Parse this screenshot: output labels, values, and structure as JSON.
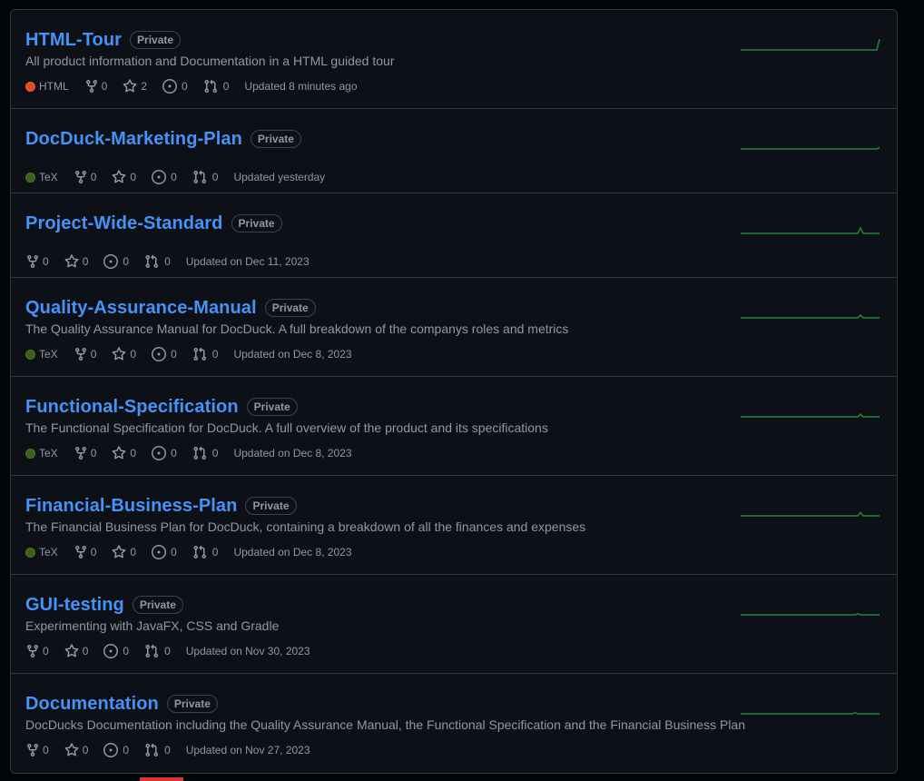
{
  "repos": [
    {
      "name": "HTML-Tour",
      "badge": "Private",
      "description": "All product information and Documentation in a HTML guided tour",
      "language": "HTML",
      "language_color": "#e34c26",
      "forks": "0",
      "stars": "2",
      "issues": "0",
      "pulls": "0",
      "updated": "Updated 8 minutes ago",
      "activity": [
        0,
        0,
        0,
        0,
        0,
        0,
        0,
        0,
        0,
        0,
        0,
        0,
        0,
        0,
        0,
        0,
        0,
        0,
        0,
        0,
        0,
        0,
        0,
        0,
        0,
        0,
        0,
        0,
        0,
        0,
        0,
        0,
        0,
        0,
        0,
        0,
        0,
        0,
        0,
        0,
        0,
        0,
        0,
        0,
        0,
        0,
        0,
        0,
        0,
        0,
        0,
        1
      ]
    },
    {
      "name": "DocDuck-Marketing-Plan",
      "badge": "Private",
      "description": "",
      "language": "TeX",
      "language_color": "#3d6117",
      "forks": "0",
      "stars": "0",
      "issues": "0",
      "pulls": "0",
      "updated": "Updated yesterday",
      "activity": [
        0,
        0,
        0,
        0,
        0,
        0,
        0,
        0,
        0,
        0,
        0,
        0,
        0,
        0,
        0,
        0,
        0,
        0,
        0,
        0,
        0,
        0,
        0,
        0,
        0,
        0,
        0,
        0,
        0,
        0,
        0,
        0,
        0,
        0,
        0,
        0,
        0,
        0,
        0,
        0,
        0,
        0,
        0,
        0,
        0,
        0,
        0,
        0,
        0,
        0,
        0,
        0.15
      ]
    },
    {
      "name": "Project-Wide-Standard",
      "badge": "Private",
      "description": "",
      "language": "",
      "language_color": "",
      "forks": "0",
      "stars": "0",
      "issues": "0",
      "pulls": "0",
      "updated": "Updated on Dec 11, 2023",
      "activity": [
        0,
        0,
        0,
        0,
        0,
        0,
        0,
        0,
        0,
        0,
        0,
        0,
        0,
        0,
        0,
        0,
        0,
        0,
        0,
        0,
        0,
        0,
        0,
        0,
        0,
        0,
        0,
        0,
        0,
        0,
        0,
        0,
        0,
        0,
        0,
        0,
        0,
        0,
        0,
        0,
        0,
        0,
        0,
        0,
        0.5,
        0,
        0,
        0,
        0,
        0,
        0,
        0
      ]
    },
    {
      "name": "Quality-Assurance-Manual",
      "badge": "Private",
      "description": "The Quality Assurance Manual for DocDuck. A full breakdown of the companys roles and metrics",
      "language": "TeX",
      "language_color": "#3d6117",
      "forks": "0",
      "stars": "0",
      "issues": "0",
      "pulls": "0",
      "updated": "Updated on Dec 8, 2023",
      "activity": [
        0,
        0,
        0,
        0,
        0,
        0,
        0,
        0,
        0,
        0,
        0,
        0,
        0,
        0,
        0,
        0,
        0,
        0,
        0,
        0,
        0,
        0,
        0,
        0,
        0,
        0,
        0,
        0,
        0,
        0,
        0,
        0,
        0,
        0,
        0,
        0,
        0,
        0,
        0,
        0,
        0,
        0,
        0,
        0,
        0.25,
        0,
        0,
        0,
        0,
        0,
        0,
        0
      ]
    },
    {
      "name": "Functional-Specification",
      "badge": "Private",
      "description": "The Functional Specification for DocDuck. A full overview of the product and its specifications",
      "language": "TeX",
      "language_color": "#3d6117",
      "forks": "0",
      "stars": "0",
      "issues": "0",
      "pulls": "0",
      "updated": "Updated on Dec 8, 2023",
      "activity": [
        0,
        0,
        0,
        0,
        0,
        0,
        0,
        0,
        0,
        0,
        0,
        0,
        0,
        0,
        0,
        0,
        0,
        0,
        0,
        0,
        0,
        0,
        0,
        0,
        0,
        0,
        0,
        0,
        0,
        0,
        0,
        0,
        0,
        0,
        0,
        0,
        0,
        0,
        0,
        0,
        0,
        0,
        0,
        0,
        0.25,
        0,
        0,
        0,
        0,
        0,
        0,
        0
      ]
    },
    {
      "name": "Financial-Business-Plan",
      "badge": "Private",
      "description": "The Financial Business Plan for DocDuck, containing a breakdown of all the finances and expenses",
      "language": "TeX",
      "language_color": "#3d6117",
      "forks": "0",
      "stars": "0",
      "issues": "0",
      "pulls": "0",
      "updated": "Updated on Dec 8, 2023",
      "activity": [
        0,
        0,
        0,
        0,
        0,
        0,
        0,
        0,
        0,
        0,
        0,
        0,
        0,
        0,
        0,
        0,
        0,
        0,
        0,
        0,
        0,
        0,
        0,
        0,
        0,
        0,
        0,
        0,
        0,
        0,
        0,
        0,
        0,
        0,
        0,
        0,
        0,
        0,
        0,
        0,
        0,
        0,
        0,
        0,
        0.3,
        0,
        0,
        0,
        0,
        0,
        0,
        0
      ]
    },
    {
      "name": "GUI-testing",
      "badge": "Private",
      "description": "Experimenting with JavaFX, CSS and Gradle",
      "language": "",
      "language_color": "",
      "forks": "0",
      "stars": "0",
      "issues": "0",
      "pulls": "0",
      "updated": "Updated on Nov 30, 2023",
      "activity": [
        0,
        0,
        0,
        0,
        0,
        0,
        0,
        0,
        0,
        0,
        0,
        0,
        0,
        0,
        0,
        0,
        0,
        0,
        0,
        0,
        0,
        0,
        0,
        0,
        0,
        0,
        0,
        0,
        0,
        0,
        0,
        0,
        0,
        0,
        0,
        0,
        0,
        0,
        0,
        0,
        0,
        0,
        0,
        0.1,
        0,
        0,
        0,
        0,
        0,
        0,
        0,
        0
      ]
    },
    {
      "name": "Documentation",
      "badge": "Private",
      "description": "DocDucks Documentation including the Quality Assurance Manual, the Functional Specification and the Financial Business Plan",
      "language": "",
      "language_color": "",
      "forks": "0",
      "stars": "0",
      "issues": "0",
      "pulls": "0",
      "updated": "Updated on Nov 27, 2023",
      "activity": [
        0,
        0,
        0,
        0,
        0,
        0,
        0,
        0,
        0,
        0,
        0,
        0,
        0,
        0,
        0,
        0,
        0,
        0,
        0,
        0,
        0,
        0,
        0,
        0,
        0,
        0,
        0,
        0,
        0,
        0,
        0,
        0,
        0,
        0,
        0,
        0,
        0,
        0,
        0,
        0,
        0,
        0,
        0.1,
        0,
        0,
        0,
        0,
        0,
        0,
        0,
        0,
        0
      ]
    }
  ],
  "colors": {
    "link": "#4493f8",
    "spark": "#238636",
    "background": "#0d1117",
    "border": "#30363d"
  }
}
